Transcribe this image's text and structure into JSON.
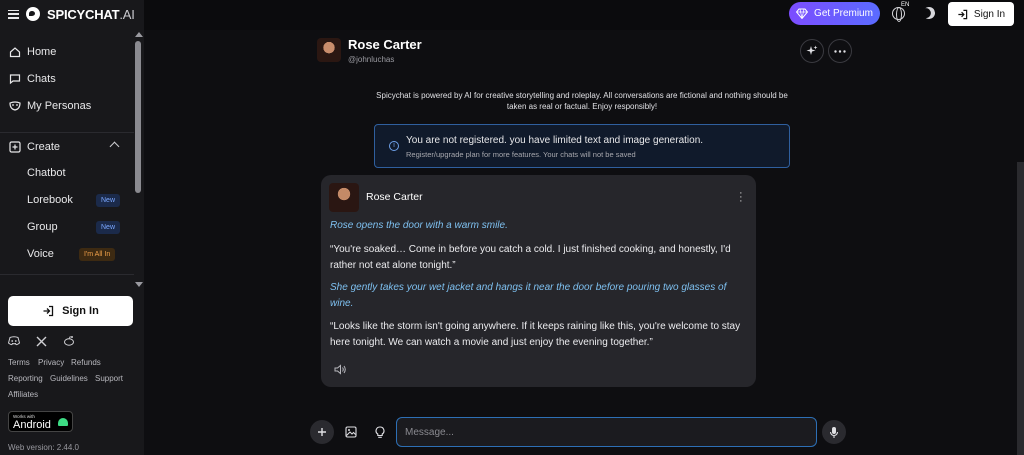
{
  "brand": {
    "name": "SPICYCHAT",
    "suffix": ".AI"
  },
  "sidebar": {
    "nav": [
      {
        "label": "Home"
      },
      {
        "label": "Chats"
      },
      {
        "label": "My Personas"
      }
    ],
    "create": {
      "label": "Create",
      "items": [
        {
          "label": "Chatbot"
        },
        {
          "label": "Lorebook",
          "badge": "New"
        },
        {
          "label": "Group",
          "badge": "New"
        },
        {
          "label": "Voice",
          "badge": "I'm All In"
        }
      ]
    },
    "sign_in": "Sign In",
    "footer_links": [
      "Terms",
      "Privacy",
      "Refunds",
      "Reporting",
      "Guidelines",
      "Support",
      "Affiliates"
    ],
    "android_badge": {
      "small": "Works with",
      "big": "Android"
    },
    "version": "Web version: 2.44.0"
  },
  "topbar": {
    "premium": "Get Premium",
    "lang": "EN",
    "sign_in": "Sign In"
  },
  "character": {
    "name": "Rose Carter",
    "handle": "@johnluchas"
  },
  "disclaimer": "Spicychat is powered by AI for creative storytelling and roleplay. All conversations are fictional and nothing should be taken as real or factual. Enjoy responsibly!",
  "notice": {
    "title": "You are not registered. you have limited text and image generation.",
    "subtitle": "Register/upgrade plan for more features. Your chats will not be saved"
  },
  "message": {
    "author": "Rose Carter",
    "paragraphs": [
      {
        "text": "Rose opens the door with a warm smile.",
        "style": "action"
      },
      {
        "text": "“You're soaked… Come in before you catch a cold. I just finished cooking, and honestly, I'd rather not eat alone tonight.”",
        "style": "speech"
      },
      {
        "text": "She gently takes your wet jacket and hangs it near the door before pouring two glasses of wine.",
        "style": "action"
      },
      {
        "text": "“Looks like the storm isn't going anywhere. If it keeps raining like this, you're welcome to stay here tonight. We can watch a movie and just enjoy the evening together.”",
        "style": "speech"
      }
    ]
  },
  "composer": {
    "placeholder": "Message...",
    "value": ""
  },
  "colors": {
    "accent": "#7c4dff",
    "action_text": "#7ec0f0",
    "input_border": "#2d6fb5"
  }
}
